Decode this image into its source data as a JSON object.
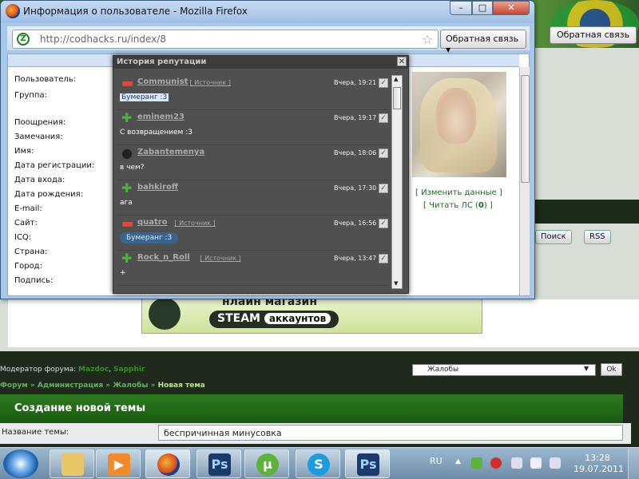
{
  "background": {
    "feedback_btn": "Обратная связь",
    "search_btn": "Поиск",
    "rss_btn": "RSS",
    "steam_banner_top": "нлайн магазин",
    "steam_banner_main": "STEAM",
    "steam_banner_sub": "аккаунтов",
    "moderator_label": "Модератор форума:",
    "moderators": [
      "Mazdoc",
      "Sapphir"
    ],
    "breadcrumb": [
      "Форум",
      "Администрация",
      "Жалобы",
      "Новая тема"
    ],
    "category_select": "Жалобы",
    "ok_btn": "Ok",
    "new_topic_heading": "Создание новой темы",
    "topic_name_label": "Название темы:",
    "topic_name_value": "беспричинная минусовка"
  },
  "window": {
    "title": "Информация о пользователе - Mozilla Firefox",
    "url": "http://codhacks.ru/index/8",
    "feedback_btn": "Обратная связь",
    "controls": {
      "minimize": "–",
      "maximize": "□",
      "close": "✕"
    }
  },
  "profile": {
    "fields": [
      "Пользователь:",
      "Группа:",
      "Поощрения:",
      "Замечания:",
      "Имя:",
      "Дата регистрации:",
      "Дата входа:",
      "Дата рождения:",
      "E-mail:",
      "Сайт:",
      "ICQ:",
      "Страна:",
      "Город:",
      "Подпись:"
    ],
    "edit_link": "Изменить данные",
    "pm_link": "Читать ЛС",
    "pm_count": "0"
  },
  "reputation": {
    "title": "История репутации",
    "close": "✕",
    "entries": [
      {
        "type": "minus",
        "icon": "minus-icon",
        "user": "Communist",
        "source": "Источник",
        "time": "Вчера, 19:21",
        "message": "Бумеранг :3",
        "style": "selected"
      },
      {
        "type": "plus",
        "icon": "plus-icon",
        "user": "eminem23",
        "source": "",
        "time": "Вчера, 19:17",
        "message": "С возвращением :3",
        "style": ""
      },
      {
        "type": "neutral",
        "icon": "lightbulb-icon",
        "user": "Zabantemenya",
        "source": "",
        "time": "Вчера, 18:06",
        "message": "в чем?",
        "style": ""
      },
      {
        "type": "plus",
        "icon": "plus-icon",
        "user": "bahkiroff",
        "source": "",
        "time": "Вчера, 17:30",
        "message": "ага",
        "style": ""
      },
      {
        "type": "minus",
        "icon": "minus-icon",
        "user": "quatro",
        "source": "Источник",
        "time": "Вчера, 16:56",
        "message": "Бумеранг :3",
        "style": "bubble"
      },
      {
        "type": "plus",
        "icon": "plus-icon",
        "user": "Rock_n_Roll",
        "source": "Источник",
        "time": "Вчера, 13:47",
        "message": "+",
        "style": ""
      }
    ]
  },
  "taskbar": {
    "apps": [
      "explorer",
      "media-player",
      "firefox",
      "photoshop",
      "utorrent",
      "skype",
      "photoshop"
    ],
    "language": "RU",
    "time": "13:28",
    "date": "19.07.2011"
  }
}
